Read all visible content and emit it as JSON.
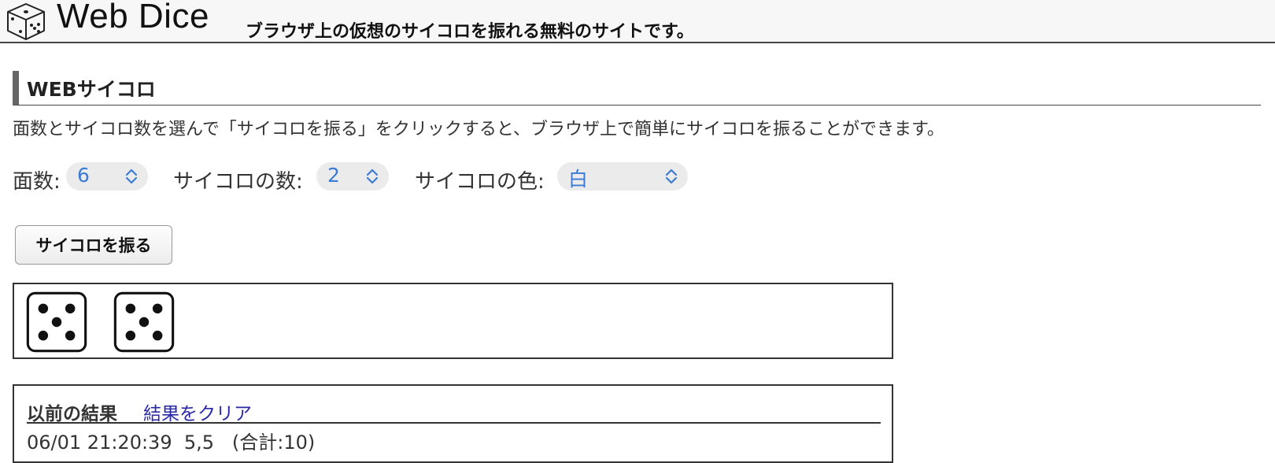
{
  "header": {
    "logo_text": "Web Dice",
    "tagline": "ブラウザ上の仮想のサイコロを振れる無料のサイトです。"
  },
  "section": {
    "title": "WEBサイコロ",
    "description": "面数とサイコロ数を選んで「サイコロを振る」をクリックすると、ブラウザ上で簡単にサイコロを振ることができます。"
  },
  "controls": {
    "faces_label": "面数:",
    "faces_value": "6",
    "count_label": "サイコロの数:",
    "count_value": "2",
    "color_label": "サイコロの色:",
    "color_value": "白"
  },
  "roll_button_label": "サイコロを振る",
  "dice_results": [
    5,
    5
  ],
  "history": {
    "title": "以前の結果",
    "clear_label": "結果をクリア",
    "rows": [
      "06/01 21:20:39  5,5   (合計:10)"
    ]
  },
  "colors": {
    "select_text": "#3b7bd6",
    "link": "#2a2aa8",
    "section_bar": "#666666"
  },
  "icons": {
    "logo": "dice-icon",
    "select_arrow": "chevron-updown-icon"
  }
}
